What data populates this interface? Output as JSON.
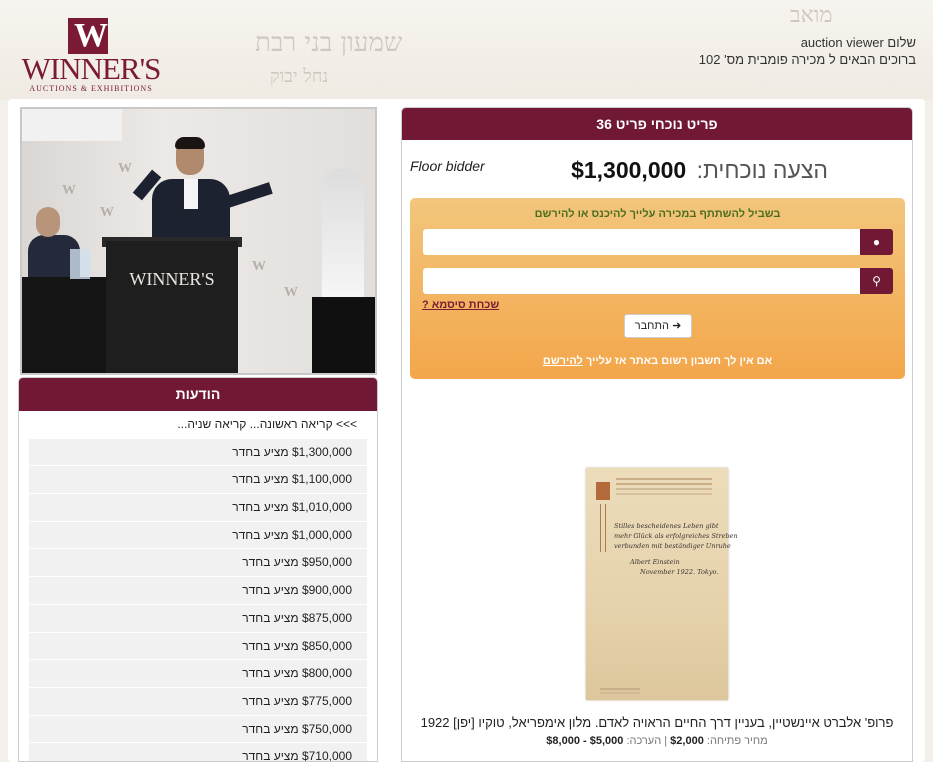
{
  "header": {
    "logo_word": "WINNER'S",
    "logo_tagline": "AUCTIONS & EXHIBITIONS",
    "greeting_name": "auction viewer",
    "greeting_hello": "שלום",
    "welcome_text": "ברוכים הבאים ל מכירה פומבית מס' 102"
  },
  "video": {
    "podium_logo": "WINNER'S"
  },
  "messages": {
    "title": "הודעות",
    "call_text": ">>> קריאה ראשונה... קריאה שניה...",
    "bid_suffix": "מציע בחדר",
    "bids": [
      "$1,300,000",
      "$1,100,000",
      "$1,010,000",
      "$1,000,000",
      "$950,000",
      "$900,000",
      "$875,000",
      "$850,000",
      "$800,000",
      "$775,000",
      "$750,000",
      "$710,000"
    ]
  },
  "lot": {
    "title": "פריט נוכחי פריט 36",
    "bid_source": "Floor bidder",
    "current_bid_label": "הצעה נוכחית:",
    "current_bid_value": "$1,300,000",
    "login": {
      "instructions": "בשביל להשתתף במכירה עלייך להיכנס או להירשם",
      "username_value": "",
      "password_value": "",
      "user_icon": "user-icon",
      "key_icon": "key-icon",
      "forgot_label": "שכחת סיסמא ?",
      "login_button": "התחבר",
      "register_text": "אם אין לך חשבון רשום באתר אז עלייך",
      "register_link": "להירשם"
    },
    "description": "פרופ' אלברט איינשטיין, בעניין דרך החיים הראויה לאדם. מלון אימפריאל, טוקיו [יפן] 1922",
    "opening_label": "מחיר פתיחה:",
    "opening_price": "$2,000",
    "estimate_label": "הערכה:",
    "estimate_value": "$5,000 - $8,000"
  },
  "colors": {
    "brand": "#701834",
    "login_gradient_top": "#f2c67c",
    "login_gradient_bottom": "#f3a64a"
  }
}
